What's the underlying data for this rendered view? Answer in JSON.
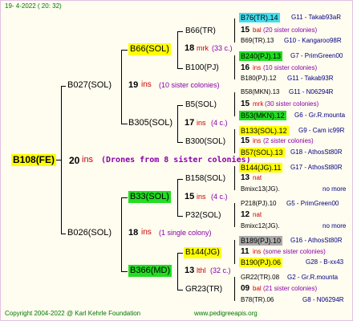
{
  "header": {
    "date": "19-  4-2022 (  20:  32)"
  },
  "footer": {
    "copyright": "Copyright 2004-2022 @ Karl Kehrle Foundation",
    "url": "www.pedigreeapis.org"
  },
  "root": {
    "name": "B108(FE)",
    "count": "20",
    "ins": "ins",
    "note": "(Drones from 8 sister colonies)"
  },
  "gen1": [
    {
      "name": "B027(SOL)",
      "count": "19",
      "ins": "ins",
      "note": "(10 sister colonies)"
    },
    {
      "name": "B026(SOL)",
      "count": "18",
      "ins": "ins",
      "note": "(1 single colony)"
    }
  ],
  "gen2": [
    {
      "name": "B66(SOL)",
      "count": "18",
      "ins": "mrk",
      "note": "(33 c.)"
    },
    {
      "name": "B305(SOL)",
      "count": "17",
      "ins": "ins",
      "note": "(4 c.)"
    },
    {
      "name": "B33(SOL)",
      "count": "15",
      "ins": "ins",
      "note": "(4 c.)"
    },
    {
      "name": "B366(MD)",
      "count": "13",
      "ins": "lthl",
      "note": "(32 c.)"
    }
  ],
  "gen3": [
    {
      "name": "B66(TR)"
    },
    {
      "name": "B100(PJ)"
    },
    {
      "name": "B5(SOL)"
    },
    {
      "name": "B300(SOL)"
    },
    {
      "name": "B158(SOL)"
    },
    {
      "name": "P32(SOL)"
    },
    {
      "name": "B144(JG)"
    },
    {
      "name": "GR23(TR)"
    }
  ],
  "gen4": [
    {
      "name": "B76(TR).14",
      "right": "G11 - Takab93aR",
      "count": "15",
      "ins": "bal",
      "note": "(20 sister colonies)"
    },
    {
      "name": "B69(TR).13",
      "right": "G10 - Kangaroo98R"
    },
    {
      "name": "B240(PJ).13",
      "right": "G7 - PrimGreen00",
      "count": "16",
      "ins": "ins",
      "note": "(10 sister colonies)"
    },
    {
      "name": "B180(PJ).12",
      "right": "G11 - Takab93R"
    },
    {
      "name": "B58(MKN).13",
      "right": "G11 - N06294R",
      "count": "15",
      "ins": "mrk",
      "note": "(30 sister colonies)"
    },
    {
      "name": "B53(MKN).12",
      "right": "G6 - Gr.R.mounta"
    },
    {
      "name": "B133(SOL).12",
      "right": "G9 - Cam ic99R",
      "count": "15",
      "ins": "ins",
      "note": "(2 sister colonies)"
    },
    {
      "name": "B57(SOL).13",
      "right": "G18 - AthosSt80R"
    },
    {
      "name": "B144(JG).11",
      "right": "G17 - AthosSt80R",
      "count": "13",
      "ins": "nat",
      "note": ""
    },
    {
      "name": "Bmixc13(JG).",
      "right": "no more"
    },
    {
      "name": "P218(PJ).10",
      "right": "G5 - PrimGreen00",
      "count": "12",
      "ins": "nat",
      "note": ""
    },
    {
      "name": "Bmixc12(JG).",
      "right": "no more"
    },
    {
      "name": "B189(PJ).10",
      "right": "G16 - AthosSt80R",
      "count": "11",
      "ins": "ins",
      "note": "(some sister colonies)"
    },
    {
      "name": "B190(PJ).06",
      "right": "G28 - B-xx43"
    },
    {
      "name": "GR22(TR).08",
      "right": "G2 - Gr.R.mounta",
      "count": "09",
      "ins": "bal",
      "note": "(21 sister colonies)"
    },
    {
      "name": "B78(TR).06",
      "right": "G8 - N06294R"
    }
  ],
  "colors": {
    "yellow": "#ffff00",
    "green": "#22dd22",
    "cyan": "#44ddee",
    "gray": "#aaaaaa",
    "ins_red": "#cc0000",
    "note_purple": "#8800aa",
    "border": "#e3c0e3",
    "background": "#fffcf0"
  }
}
